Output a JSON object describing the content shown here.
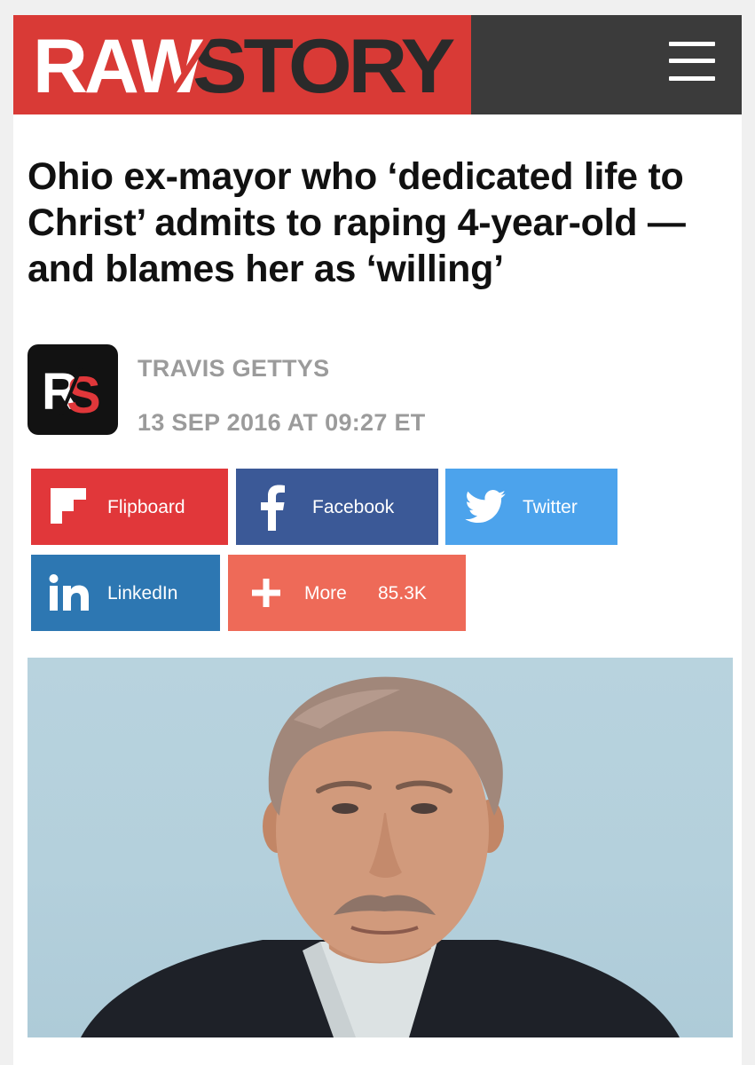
{
  "header": {
    "logo_text": "RAWSTORY",
    "brand_color": "#d93a36",
    "bar_color": "#3b3b3b",
    "menu_icon": "hamburger-icon"
  },
  "article": {
    "headline": "Ohio ex-mayor who ‘dedicated life to Christ’ admits to raping 4-year-old — and blames her as ‘willing’",
    "author": "TRAVIS GETTYS",
    "date": "13 SEP 2016 AT 09:27 ET",
    "avatar_text": "RS"
  },
  "share_buttons": [
    {
      "label": "Flipboard",
      "icon": "flipboard-icon",
      "color": "#e1373a"
    },
    {
      "label": "Facebook",
      "icon": "facebook-icon",
      "color": "#3b5997"
    },
    {
      "label": "Twitter",
      "icon": "twitter-icon",
      "color": "#4ca3ec"
    },
    {
      "label": "LinkedIn",
      "icon": "linkedin-icon",
      "color": "#2d77b2"
    },
    {
      "label": "More",
      "icon": "plus-icon",
      "color": "#ee6a58",
      "count": "85.3K"
    }
  ]
}
